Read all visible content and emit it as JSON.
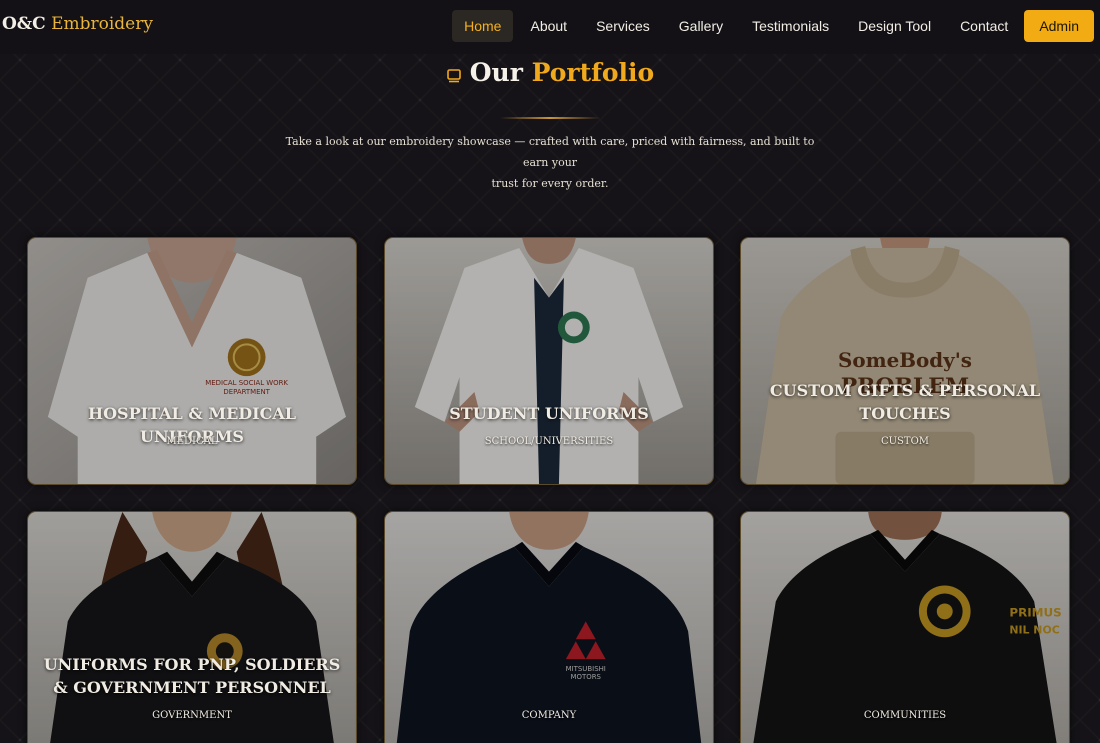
{
  "nav": {
    "brand_first": "O&C",
    "brand_second": "Embroidery",
    "items": [
      "Home",
      "About",
      "Services",
      "Gallery",
      "Testimonials",
      "Design Tool",
      "Contact"
    ],
    "active": "Home",
    "admin_label": "Admin"
  },
  "section": {
    "title_first": "Our",
    "title_second": "Portfolio",
    "intro_line1": "Take a look at our embroidery showcase — crafted with care, priced with fairness, and built to earn your",
    "intro_line2": "trust for every order."
  },
  "cards": [
    {
      "title": "HOSPITAL & MEDICAL UNIFORMS",
      "category": "MEDICAL",
      "image": "white medical scrub top with round embroidered patch"
    },
    {
      "title": "STUDENT UNIFORMS",
      "category": "SCHOOL/UNIVERSITIES",
      "image": "white lab coat with green embroidered crest"
    },
    {
      "title": "CUSTOM GIFTS & PERSONAL TOUCHES",
      "category": "CUSTOM",
      "image": "beige hoodie with brown embroidered text"
    },
    {
      "title": "UNIFORMS FOR PNP, SOLDIERS & GOVERNMENT PERSONNEL",
      "category": "GOVERNMENT",
      "image": "black polo with gold security badge"
    },
    {
      "title": "",
      "category": "COMPANY",
      "image": "black polo with red company logo"
    },
    {
      "title": "",
      "category": "COMMUNITIES",
      "image": "black polo with gold round community emblem"
    }
  ],
  "colors": {
    "accent": "#f2ab12",
    "gold": "#f0a81c",
    "background": "#151317"
  }
}
